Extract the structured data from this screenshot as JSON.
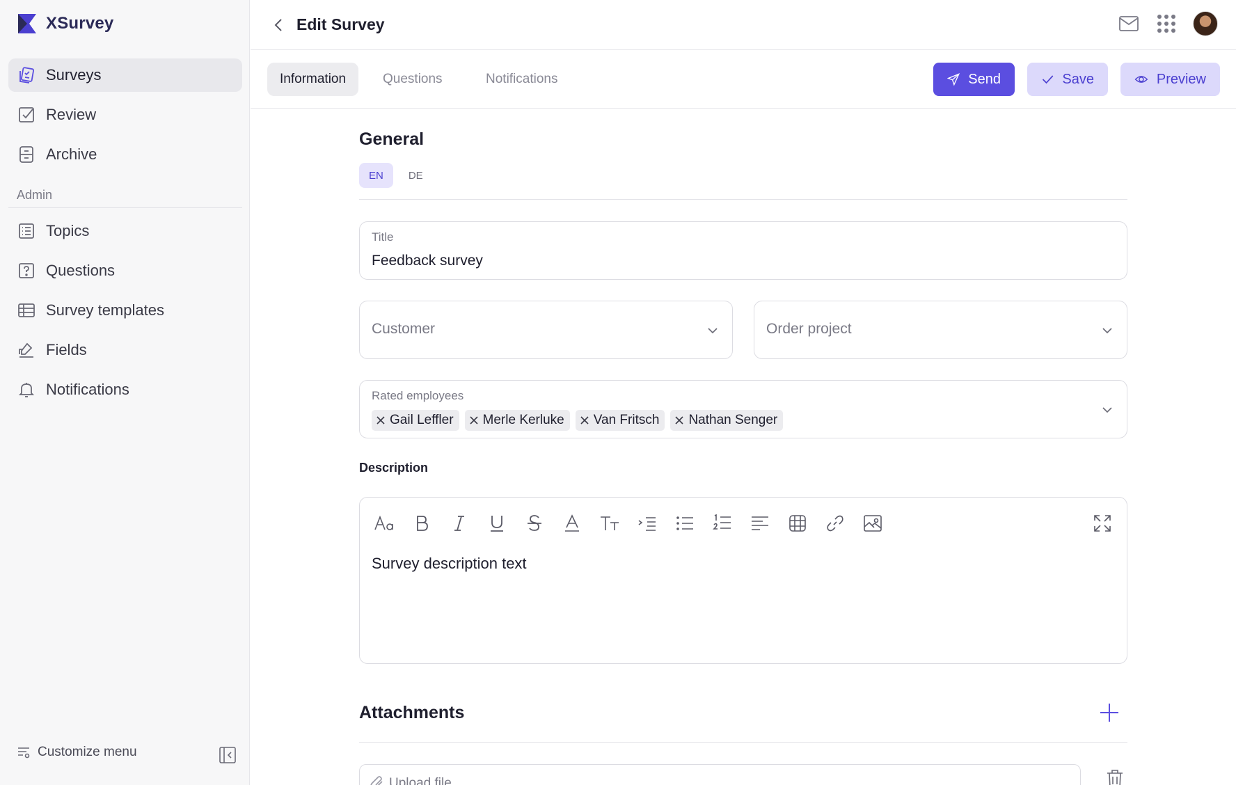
{
  "app": {
    "name": "XSurvey",
    "accent": "#5b4ee0"
  },
  "sidebar": {
    "items": [
      {
        "label": "Surveys",
        "icon": "surveys-icon",
        "active": true
      },
      {
        "label": "Review",
        "icon": "review-icon"
      },
      {
        "label": "Archive",
        "icon": "archive-icon"
      }
    ],
    "admin_label": "Admin",
    "admin_items": [
      {
        "label": "Topics",
        "icon": "topics-icon"
      },
      {
        "label": "Questions",
        "icon": "questions-icon"
      },
      {
        "label": "Survey templates",
        "icon": "table-icon"
      },
      {
        "label": "Fields",
        "icon": "fields-icon"
      },
      {
        "label": "Notifications",
        "icon": "bell-icon"
      }
    ],
    "customize_label": "Customize menu"
  },
  "header": {
    "title": "Edit Survey"
  },
  "tabs": [
    {
      "label": "Information",
      "active": true
    },
    {
      "label": "Questions"
    },
    {
      "label": "Notifications"
    }
  ],
  "actions": {
    "send": "Send",
    "save": "Save",
    "preview": "Preview"
  },
  "general": {
    "title": "General",
    "languages": [
      {
        "label": "EN",
        "active": true
      },
      {
        "label": "DE"
      }
    ]
  },
  "form": {
    "title_label": "Title",
    "title_value": "Feedback survey",
    "customer_placeholder": "Customer",
    "order_placeholder": "Order project",
    "employees_label": "Rated employees",
    "employees": [
      "Gail Leffler",
      "Merle Kerluke",
      "Van Fritsch",
      "Nathan Senger"
    ],
    "description_label": "Description",
    "description_text": "Survey description text"
  },
  "attachments": {
    "title": "Attachments",
    "upload_placeholder": "Upload file"
  }
}
